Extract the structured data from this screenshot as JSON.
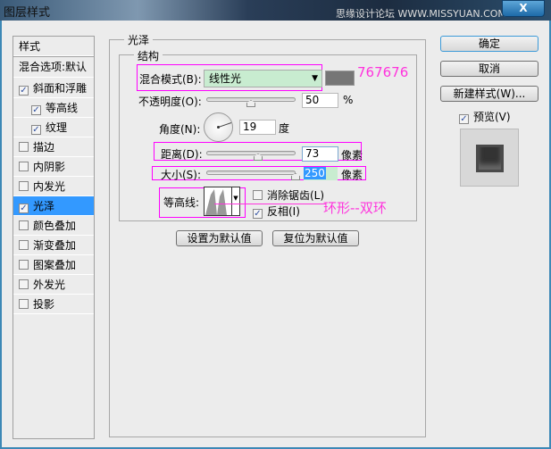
{
  "window": {
    "title": "图层样式",
    "watermark": "思缘设计论坛 WWW.MISSYUAN.COM",
    "close": "X"
  },
  "sidebar": {
    "header": "样式",
    "blend_options": "混合选项:默认",
    "items": [
      {
        "label": "斜面和浮雕",
        "checked": true,
        "indent": false
      },
      {
        "label": "等高线",
        "checked": true,
        "indent": true
      },
      {
        "label": "纹理",
        "checked": true,
        "indent": true
      },
      {
        "label": "描边",
        "checked": false,
        "indent": false
      },
      {
        "label": "内阴影",
        "checked": false,
        "indent": false
      },
      {
        "label": "内发光",
        "checked": false,
        "indent": false
      },
      {
        "label": "光泽",
        "checked": true,
        "indent": false,
        "selected": true
      },
      {
        "label": "颜色叠加",
        "checked": false,
        "indent": false
      },
      {
        "label": "渐变叠加",
        "checked": false,
        "indent": false
      },
      {
        "label": "图案叠加",
        "checked": false,
        "indent": false
      },
      {
        "label": "外发光",
        "checked": false,
        "indent": false
      },
      {
        "label": "投影",
        "checked": false,
        "indent": false
      }
    ]
  },
  "satin": {
    "title": "光泽",
    "structure": "结构",
    "blend_label": "混合模式(B):",
    "blend_value": "线性光",
    "color": "#767676",
    "opacity_label": "不透明度(O):",
    "opacity": "50",
    "opacity_unit": "%",
    "opacity_pct": 50,
    "angle_label": "角度(N):",
    "angle": "19",
    "angle_unit": "度",
    "distance_label": "距离(D):",
    "distance": "73",
    "distance_unit": "像素",
    "distance_pct": 58,
    "size_label": "大小(S):",
    "size": "250",
    "size_unit": "像素",
    "size_pct": 100,
    "contour_label": "等高线:",
    "antialias": "消除锯齿(L)",
    "antialias_checked": false,
    "invert": "反相(I)",
    "invert_checked": true,
    "make_default": "设置为默认值",
    "reset_default": "复位为默认值"
  },
  "annotations": {
    "color": "767676",
    "contour": "环形--双环"
  },
  "actions": {
    "ok": "确定",
    "cancel": "取消",
    "new_style": "新建样式(W)...",
    "preview": "预览(V)",
    "preview_checked": true
  }
}
